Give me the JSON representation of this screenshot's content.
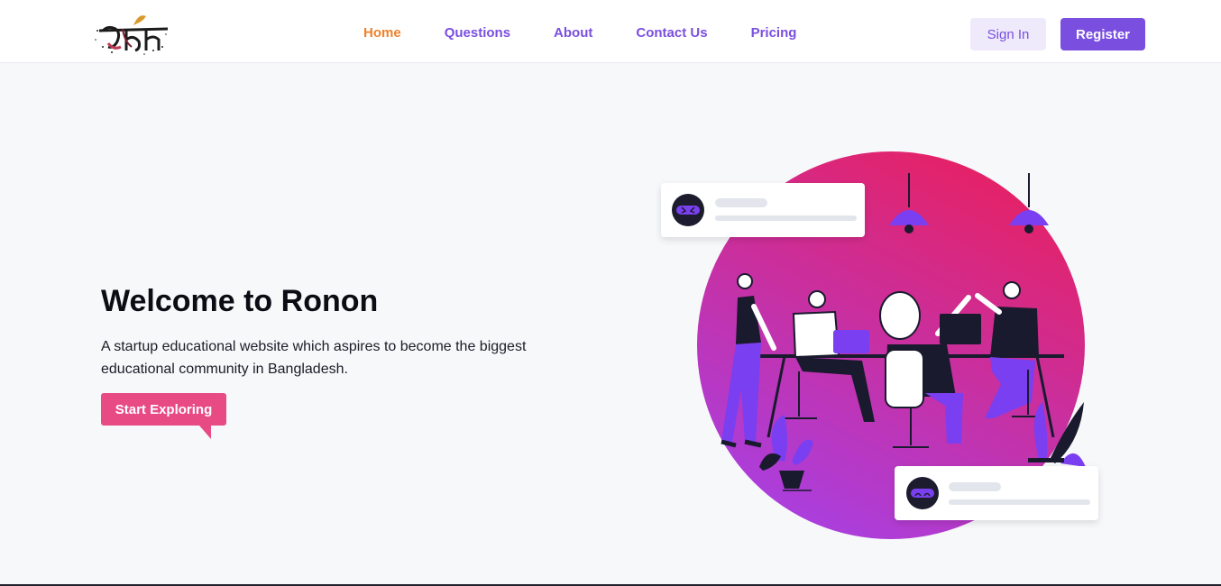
{
  "nav": {
    "links": [
      "Home",
      "Questions",
      "About",
      "Contact Us",
      "Pricing"
    ],
    "sign_in": "Sign In",
    "register": "Register"
  },
  "hero": {
    "title": "Welcome to Ronon",
    "subtitle": "A startup educational website which aspires to become the biggest educational community in Bangladesh.",
    "cta": "Start Exploring"
  },
  "colors": {
    "accent": "#7a4fe0",
    "active_nav": "#f0822b",
    "cta": "#e84a83",
    "circle_top": "#e8205f",
    "circle_bottom": "#a93fe0"
  }
}
